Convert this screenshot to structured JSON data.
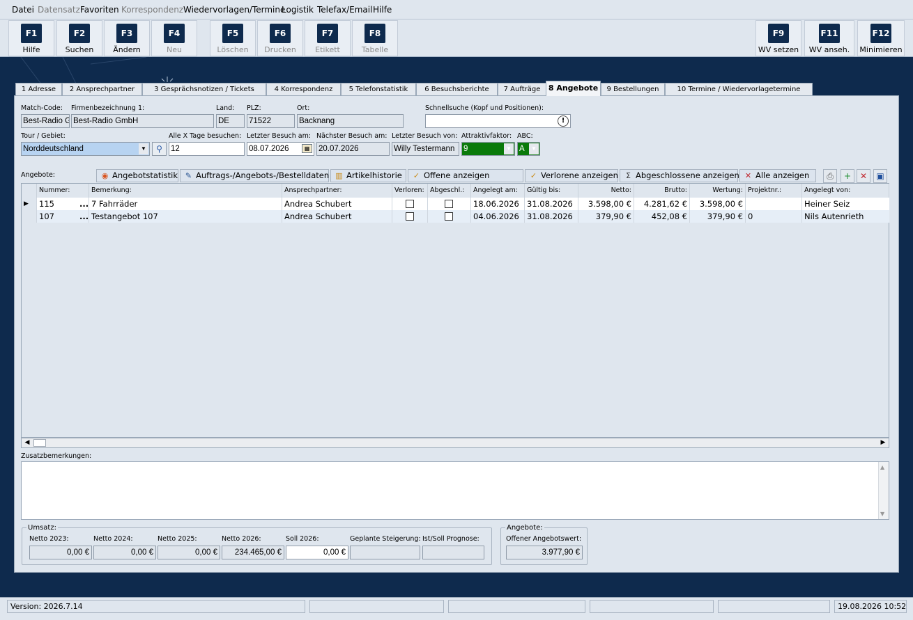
{
  "menu": [
    "Datei",
    "Datensatz",
    "Favoriten",
    "Korrespondenz",
    "Wiedervorlagen/Termine",
    "Logistik",
    "Telefax/Email",
    "Hilfe"
  ],
  "toolbar": {
    "keys": [
      {
        "key": "F1",
        "label": "Hilfe"
      },
      {
        "key": "F2",
        "label": "Suchen"
      },
      {
        "key": "F3",
        "label": "Ändern"
      },
      {
        "key": "F4",
        "label": "Neu"
      },
      {
        "key": "F5",
        "label": "Löschen"
      },
      {
        "key": "F6",
        "label": "Drucken"
      },
      {
        "key": "F7",
        "label": "Etikett"
      },
      {
        "key": "F8",
        "label": "Tabelle"
      },
      {
        "key": "F9",
        "label": "WV setzen"
      },
      {
        "key": "F11",
        "label": "WV anseh."
      },
      {
        "key": "F12",
        "label": "Minimieren"
      }
    ]
  },
  "tabs": [
    "1 Adresse",
    "2 Ansprechpartner",
    "3 Gesprächsnotizen / Tickets",
    "4 Korrespondenz",
    "5 Telefonstatistik",
    "6 Besuchsberichte",
    "7 Aufträge",
    "8 Angebote",
    "9 Bestellungen",
    "10 Termine / Wiedervorlagetermine"
  ],
  "header": {
    "match_code_label": "Match-Code:",
    "match_code": "Best-Radio Gr",
    "firma_label": "Firmenbezeichnung 1:",
    "firma": "Best-Radio GmbH",
    "land_label": "Land:",
    "land": "DE",
    "plz_label": "PLZ:",
    "plz": "71522",
    "ort_label": "Ort:",
    "ort": "Backnang",
    "schnellsuche_label": "Schnellsuche (Kopf und Positionen):",
    "schnellsuche": "",
    "tour_label": "Tour / Gebiet:",
    "tour": "Norddeutschland",
    "tage_label": "Alle X Tage besuchen:",
    "tage": "12",
    "letzter_label": "Letzter Besuch am:",
    "letzter": "08.07.2026",
    "naechster_label": "Nächster Besuch am:",
    "naechster": "20.07.2026",
    "von_label": "Letzter Besuch von:",
    "von": "Willy Testermann",
    "attraktiv_label": "Attraktivfaktor:",
    "attraktiv": "9",
    "abc_label": "ABC:",
    "abc": "A"
  },
  "angebote": {
    "label": "Angebote:",
    "buttons": [
      "Angebotstatistik",
      "Auftrags-/Angebots-/Bestelldaten",
      "Artikelhistorie",
      "Offene anzeigen",
      "Verlorene anzeigen",
      "Abgeschlossene anzeigen",
      "Alle anzeigen"
    ],
    "columns": [
      "Nummer:",
      "Bemerkung:",
      "Ansprechpartner:",
      "Verloren:",
      "Abgeschl.:",
      "Angelegt am:",
      "Gültig bis:",
      "Netto:",
      "Brutto:",
      "Wertung:",
      "Projektnr.:",
      "Angelegt von:"
    ],
    "rows": [
      {
        "nummer": "115",
        "dots": "...",
        "bemerkung": "7 Fahrräder",
        "ansprech": "Andrea Schubert",
        "angelegt": "18.06.2026",
        "gueltig": "31.08.2026",
        "netto": "3.598,00 €",
        "brutto": "4.281,62 €",
        "wertung": "3.598,00 €",
        "projekt": "",
        "von": "Heiner Seiz"
      },
      {
        "nummer": "107",
        "dots": "...",
        "bemerkung": "Testangebot 107",
        "ansprech": "Andrea Schubert",
        "angelegt": "04.06.2026",
        "gueltig": "31.08.2026",
        "netto": "379,90 €",
        "brutto": "452,08 €",
        "wertung": "379,90 €",
        "projekt": "0",
        "von": "Nils Autenrieth"
      }
    ]
  },
  "zusatz_label": "Zusatzbemerkungen:",
  "umsatz": {
    "legend": "Umsatz:",
    "fields": [
      {
        "label": "Netto 2023:",
        "value": "0,00 €"
      },
      {
        "label": "Netto 2024:",
        "value": "0,00 €"
      },
      {
        "label": "Netto 2025:",
        "value": "0,00 €"
      },
      {
        "label": "Netto 2026:",
        "value": "234.465,00 €"
      },
      {
        "label": "Soll 2026:",
        "value": "0,00 €"
      },
      {
        "label": "Geplante Steigerung:",
        "value": ""
      },
      {
        "label": "Ist/Soll Prognose:",
        "value": ""
      }
    ]
  },
  "angebote_box": {
    "legend": "Angebote:",
    "label": "Offener Angebotswert:",
    "value": "3.977,90 €"
  },
  "status": {
    "version": "Version: 2026.7.14",
    "datetime": "19.08.2026 10:52"
  },
  "colors": {
    "navy": "#0e2a4d",
    "attraktiv_green": "#0a7a0a",
    "selection": "#b7d3f1"
  }
}
